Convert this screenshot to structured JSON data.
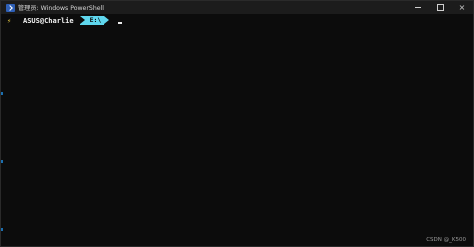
{
  "window": {
    "title": "管理员: Windows PowerShell",
    "icon": "powershell-icon",
    "controls": {
      "minimize": "minimize-icon",
      "maximize": "maximize-icon",
      "close": "×"
    }
  },
  "prompt": {
    "status_icon": "⚡",
    "user_host": "ASUS@Charlie",
    "path": "E:\\"
  },
  "watermark": "CSDN @_K500",
  "colors": {
    "background": "#0c0c0c",
    "titlebar": "#1c1c1c",
    "path_segment": "#5fd7ee",
    "bolt": "#f5d547"
  }
}
